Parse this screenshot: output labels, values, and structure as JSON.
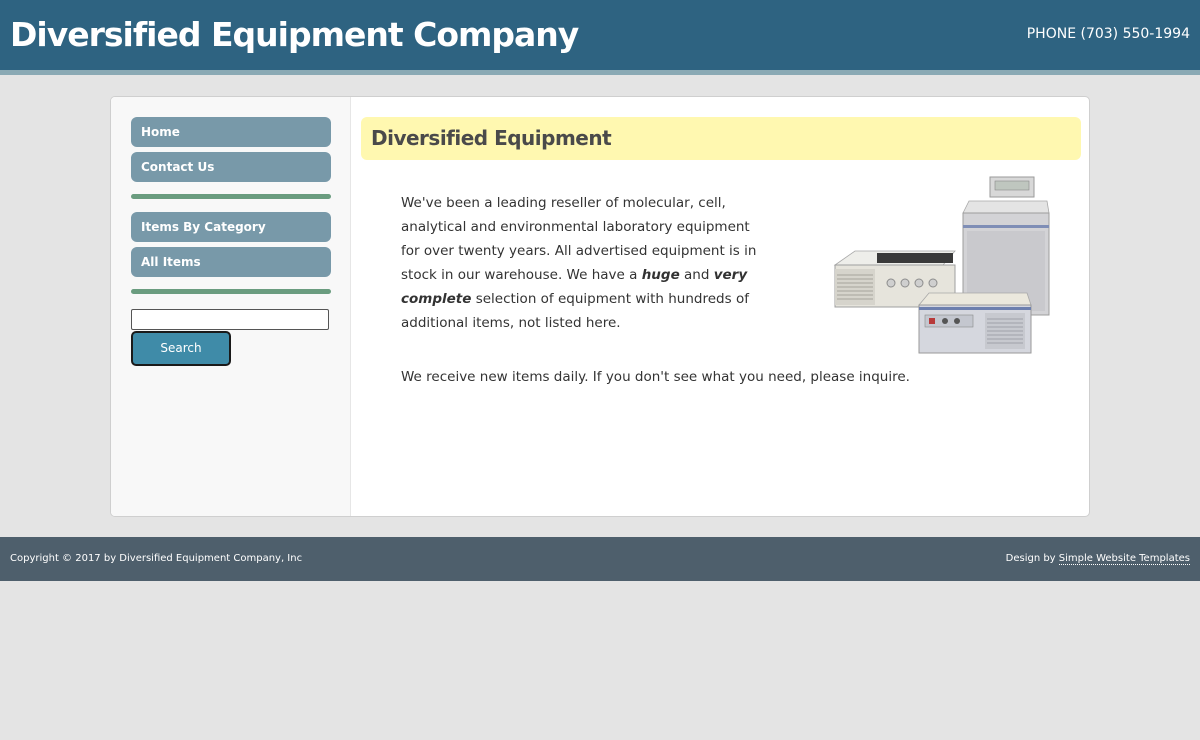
{
  "header": {
    "title": "Diversified Equipment Company",
    "phone": "PHONE (703) 550-1994"
  },
  "sidebar": {
    "nav_group_1": [
      {
        "label": "Home"
      },
      {
        "label": "Contact Us"
      }
    ],
    "nav_group_2": [
      {
        "label": "Items By Category"
      },
      {
        "label": "All Items"
      }
    ],
    "search": {
      "value": "",
      "button_label": "Search"
    }
  },
  "content": {
    "title": "Diversified Equipment",
    "para1": {
      "text_before": "We've been a leading reseller of molecular, cell, analytical and environmental laboratory equipment for over twenty years. All advertised equipment is in stock in our warehouse. We have a ",
      "emph1": "huge",
      "text_mid": " and ",
      "emph2": "very complete",
      "text_after": " selection of equipment with hundreds of additional items, not listed here."
    },
    "para2": "We receive new items daily. If you don't see what you need, please inquire."
  },
  "footer": {
    "copyright": "Copyright © 2017 by Diversified Equipment Company, Inc",
    "design_prefix": "Design by ",
    "design_link": "Simple Website Templates"
  },
  "colors": {
    "header_bg": "#2e6381",
    "nav_button": "#7899a9",
    "nav_divider": "#6a9c7f",
    "title_box": "#fff8b0",
    "search_button": "#3f8ba8",
    "footer_bg": "#4e5f6c"
  }
}
